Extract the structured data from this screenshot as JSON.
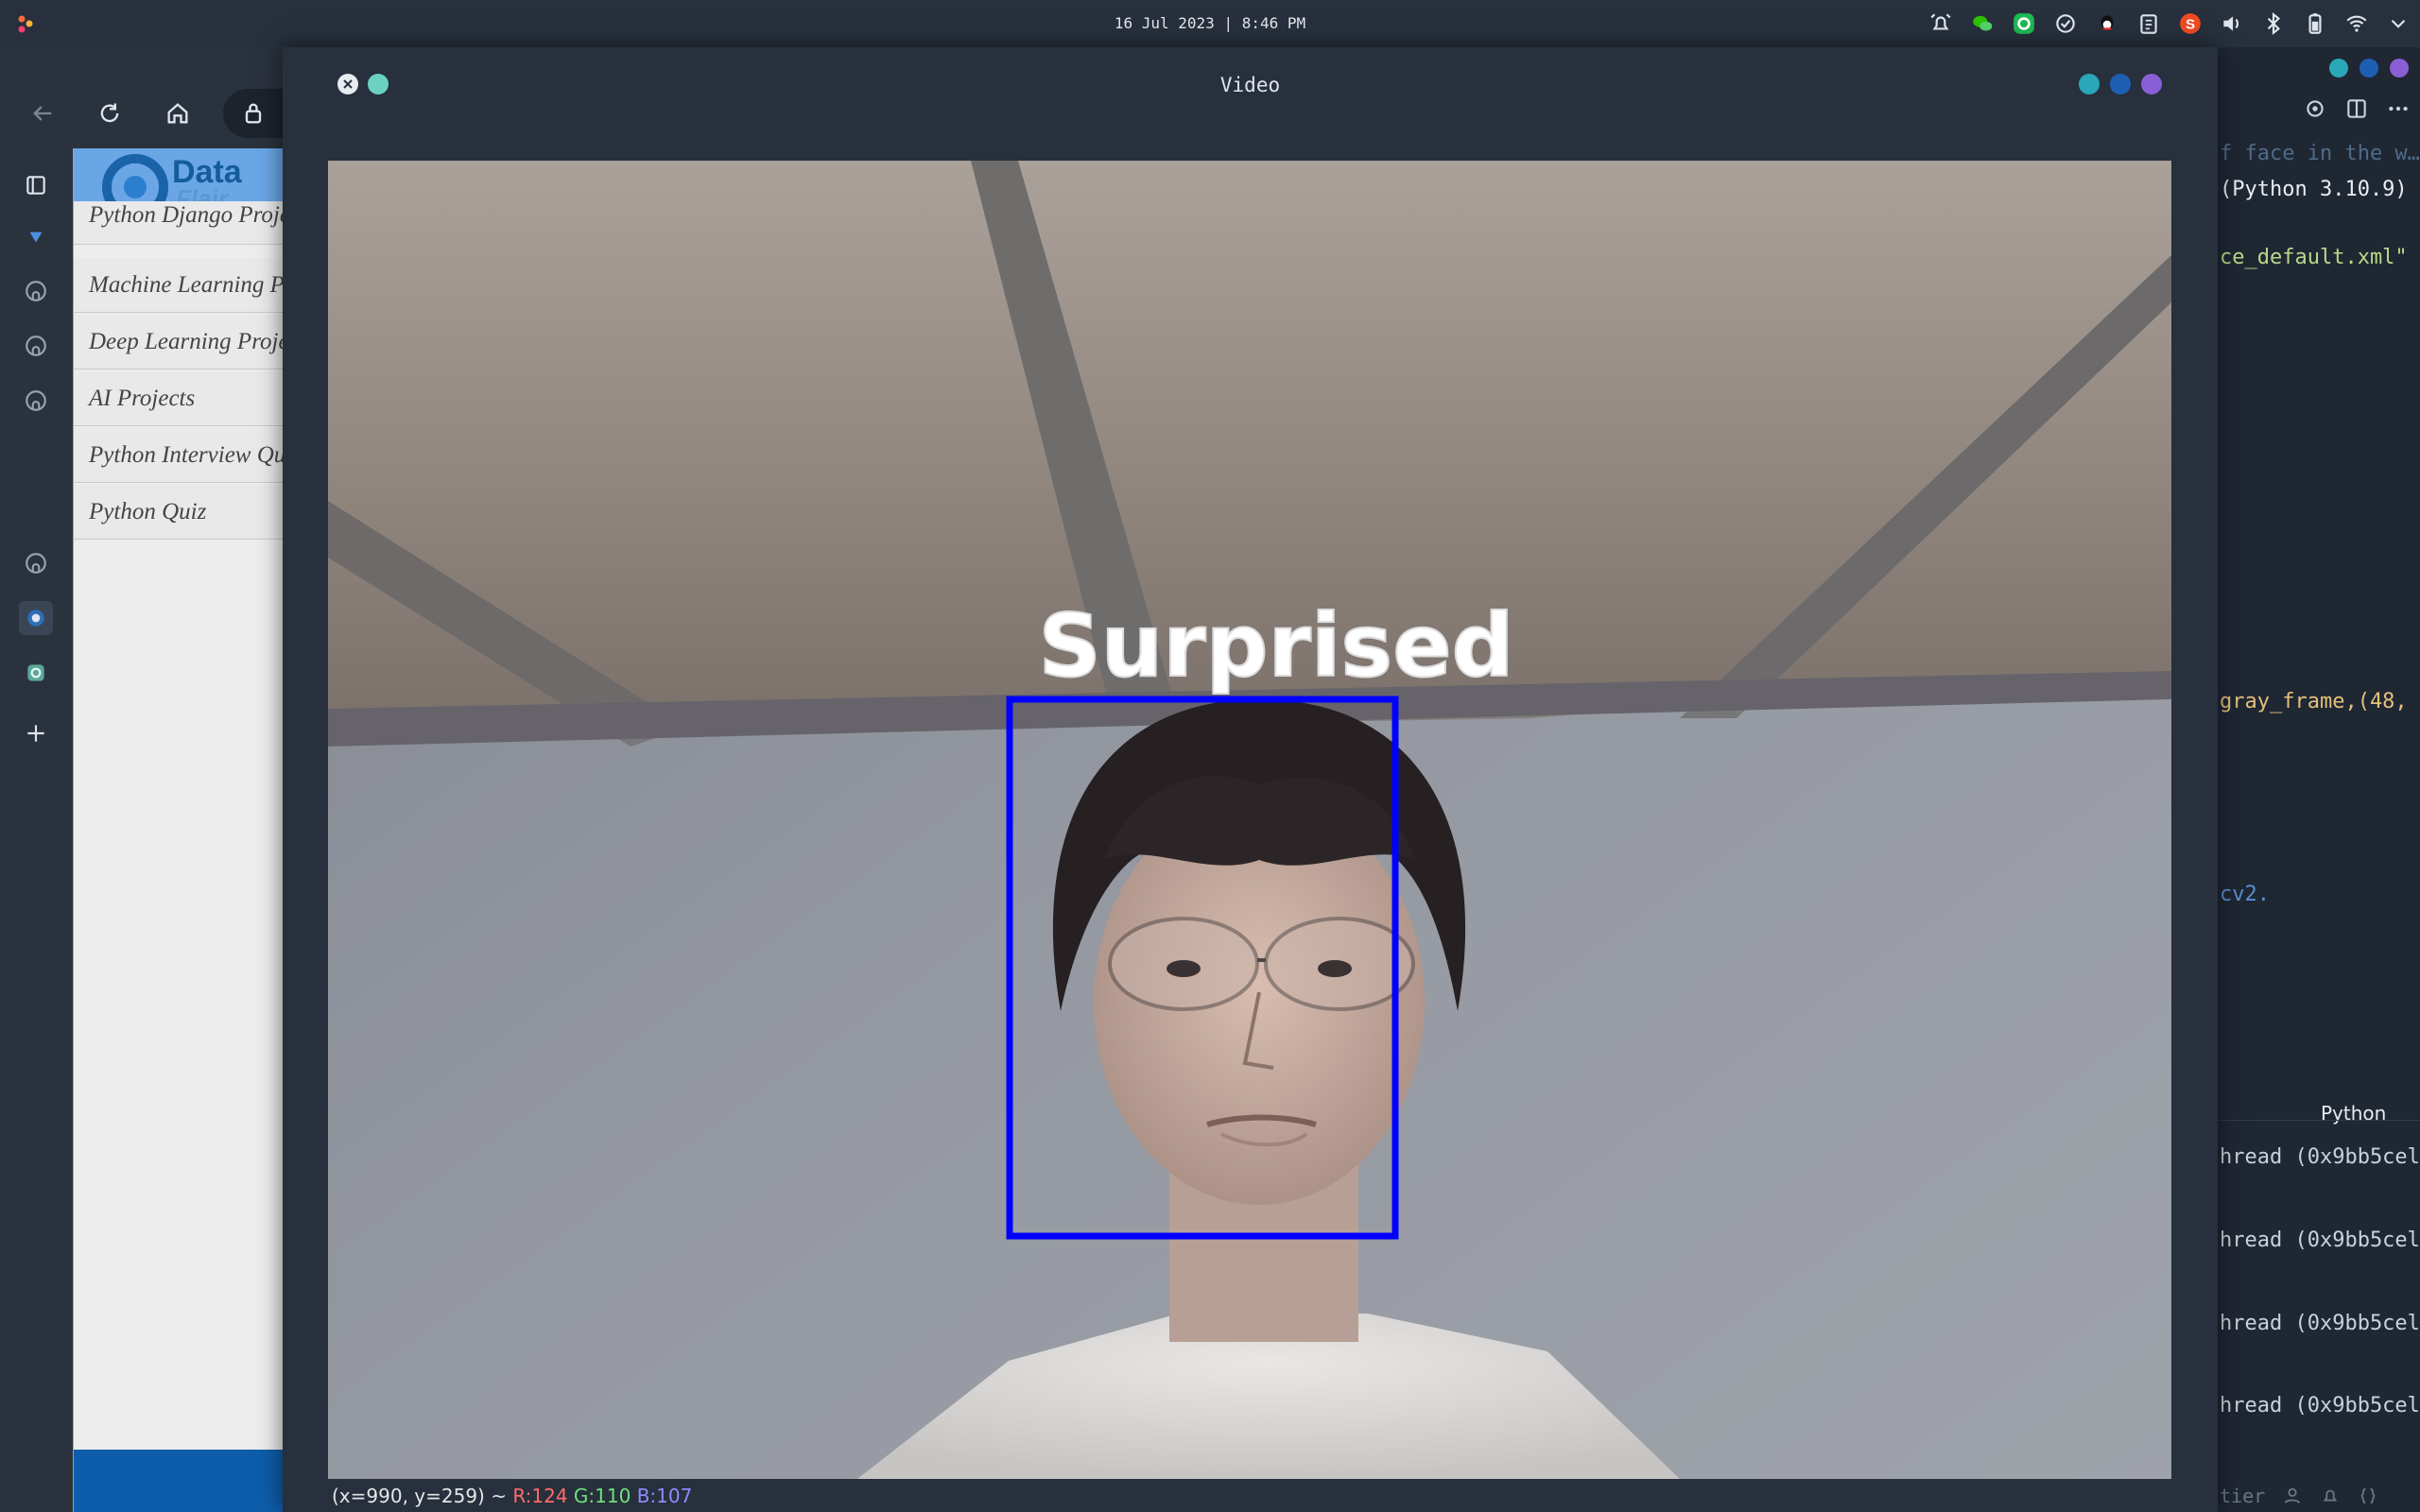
{
  "menubar": {
    "datetime": "16 Jul 2023 | 8:46 PM",
    "tray_icons": [
      "alarm-icon",
      "wechat-icon",
      "green-app-icon",
      "check-circle-icon",
      "qq-icon",
      "clipboard-icon",
      "sogou-icon",
      "volume-icon",
      "bluetooth-icon",
      "battery-icon",
      "wifi-icon",
      "chevron-down-icon"
    ],
    "sogou_letter": "S"
  },
  "browser": {
    "toolbar": [
      "back-icon",
      "reload-icon",
      "home-icon",
      "lock-icon"
    ],
    "sidebar_icons": [
      "tabs-icon",
      "gem-icon",
      "github-icon",
      "github-icon",
      "github-icon",
      "github-icon",
      "dataflair-icon",
      "chatgpt-icon",
      "plus-icon"
    ],
    "page": {
      "logo_text": "Data",
      "logo_subtext": "Flair",
      "nav_items": [
        "Python Django Projects",
        "Machine Learning Projects",
        "Deep Learning Projects",
        "AI Projects",
        "Python Interview Questions",
        "Python Quiz"
      ]
    }
  },
  "video_window": {
    "title": "Video",
    "label": "Surprised",
    "box_color": "#0000ff",
    "status": {
      "coords": "(x=990, y=259) ~",
      "r": "R:124",
      "g": "G:110",
      "b": "B:107"
    }
  },
  "editor": {
    "code_lines": [
      {
        "text": "f face in the w…",
        "color": "#4f6b88"
      },
      {
        "text": "(Python 3.10.9)",
        "color": "#e8ecf0"
      },
      {
        "text": "ce_default.xml\"",
        "color": "#b8d98a"
      },
      {
        "text": "gray_frame,(48,",
        "color": "#e5c07b"
      },
      {
        "text": "cv2.",
        "color": "#5b8fd1"
      },
      {
        "text": "Python",
        "color": "#e8ecf0"
      },
      {
        "text": "hread (0x9bb5cel",
        "color": "#c9d1da"
      },
      {
        "text": "hread (0x9bb5cel",
        "color": "#c9d1da"
      },
      {
        "text": "hread (0x9bb5cel",
        "color": "#c9d1da"
      },
      {
        "text": "hread (0x9bb5cel",
        "color": "#c9d1da"
      }
    ],
    "status_text": "tier"
  }
}
